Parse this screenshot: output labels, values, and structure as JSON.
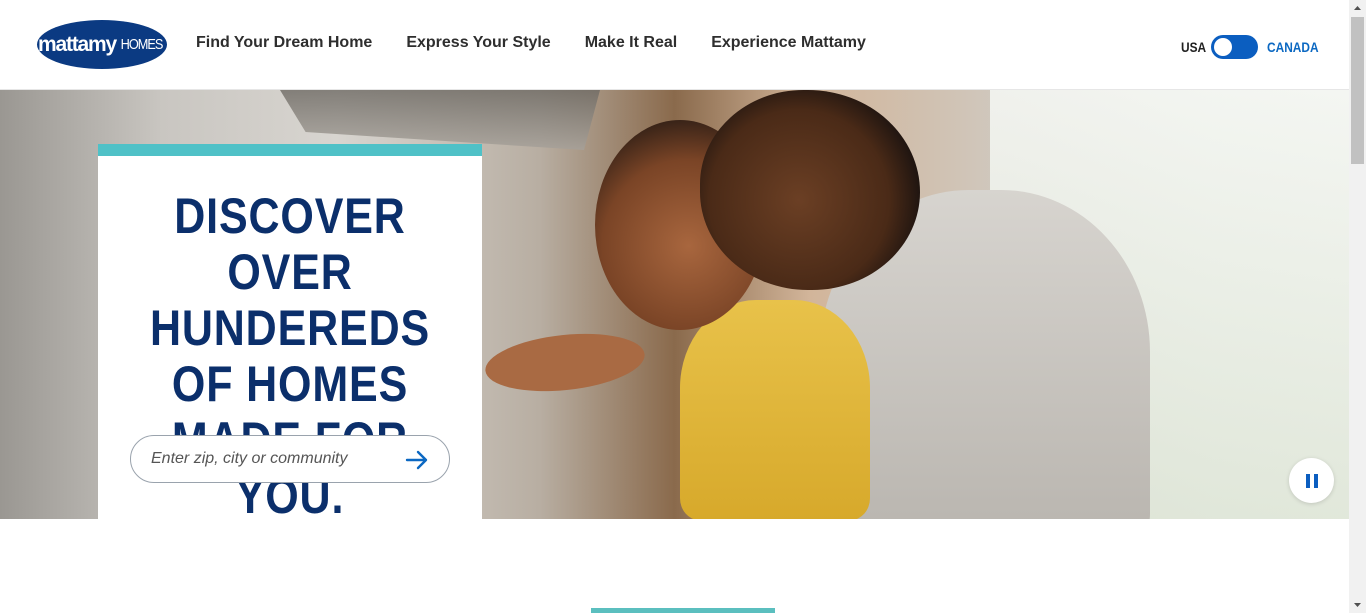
{
  "brand": {
    "logo_main": "mattamy",
    "logo_sub": "HOMES"
  },
  "nav": {
    "items": [
      {
        "label": "Find Your Dream Home"
      },
      {
        "label": "Express Your Style"
      },
      {
        "label": "Make It Real"
      },
      {
        "label": "Experience Mattamy"
      }
    ]
  },
  "country_switch": {
    "left_label": "USA",
    "right_label": "CANADA",
    "state": "USA selected"
  },
  "hero": {
    "headline": "DISCOVER OVER HUNDEREDS OF HOMES MADE FOR YOU.",
    "search": {
      "placeholder": "Enter zip, city or community",
      "value": ""
    },
    "pause_icon": "pause-icon",
    "submit_icon": "arrow-right-icon"
  },
  "colors": {
    "brand_navy": "#0b3a82",
    "headline_navy": "#0b2f6b",
    "accent_teal": "#4fc1c7",
    "link_blue": "#0b68c2",
    "toggle_blue": "#0b5ec0"
  }
}
